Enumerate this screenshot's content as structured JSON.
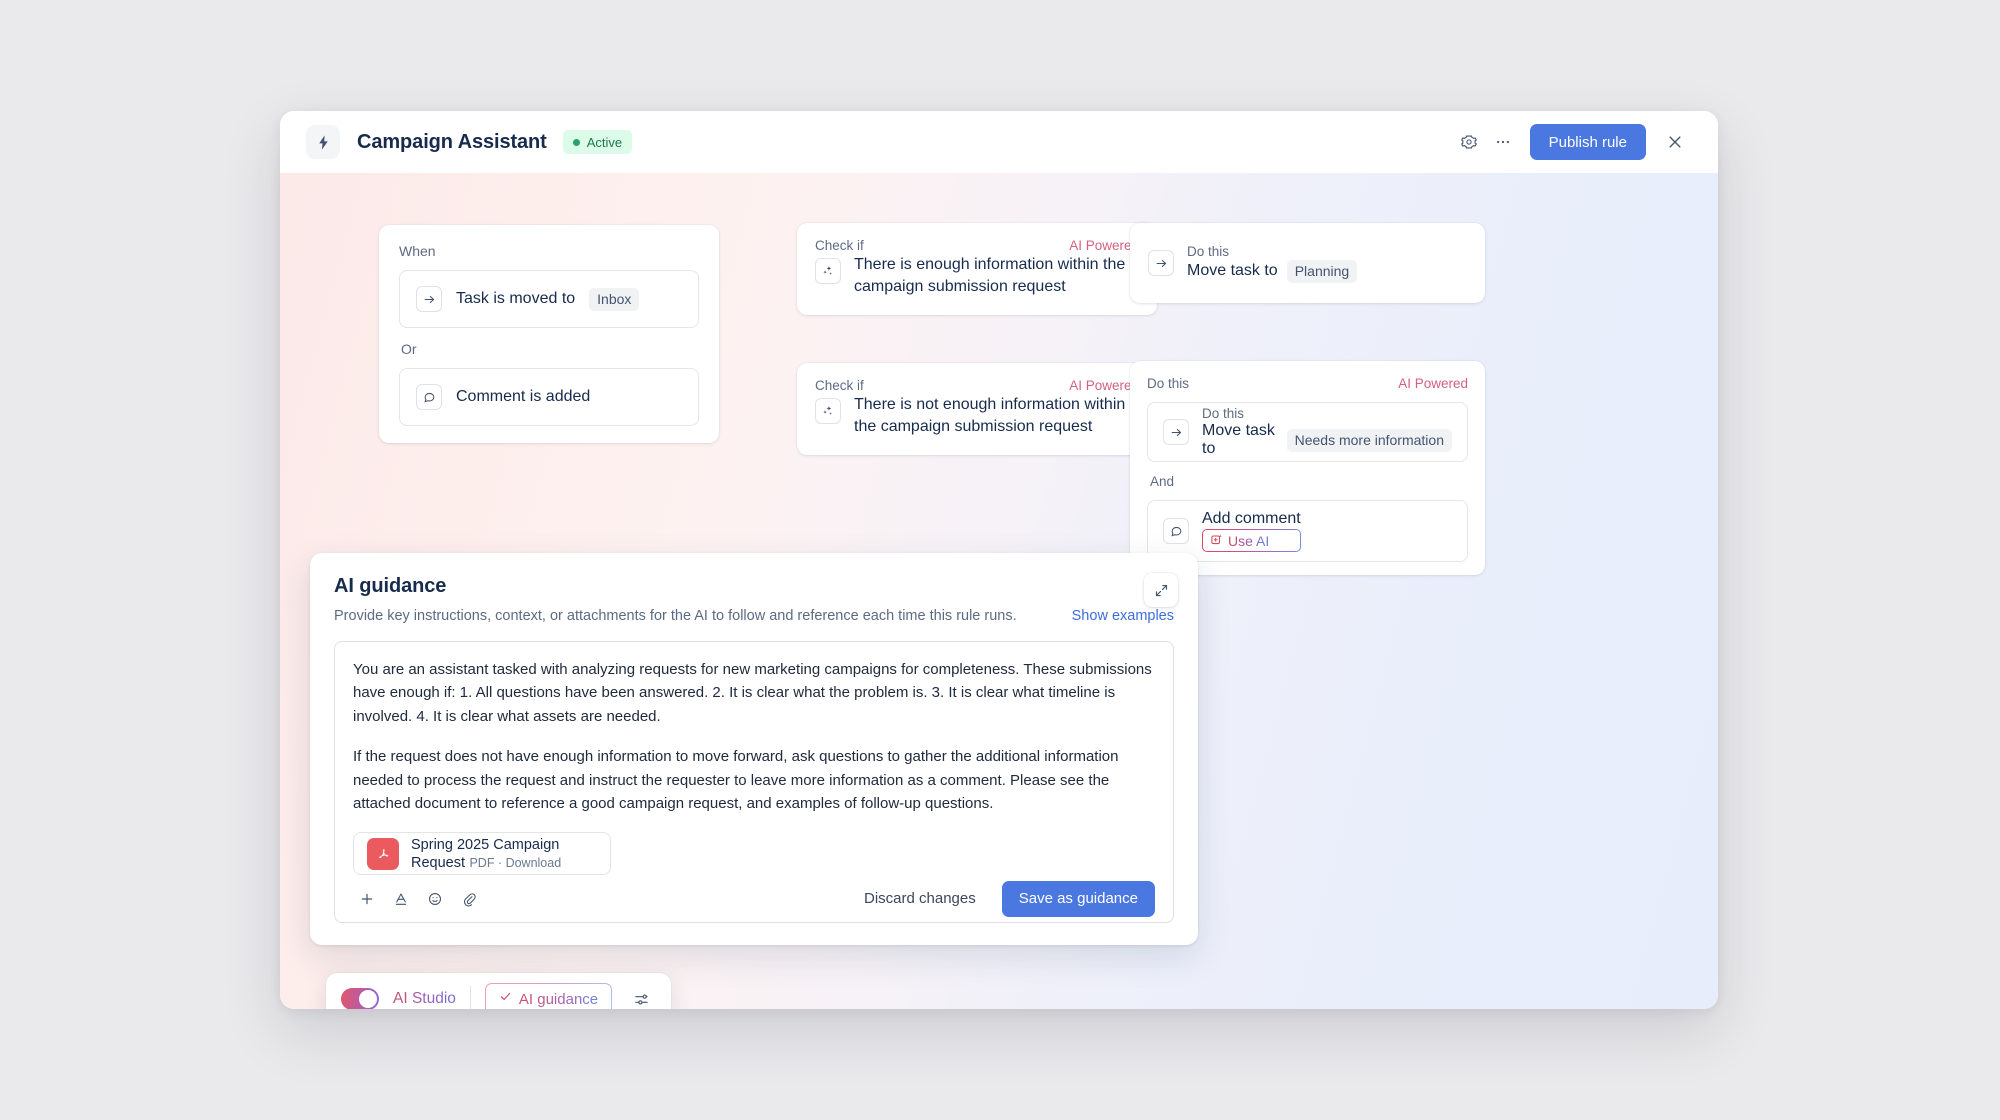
{
  "titlebar": {
    "rule_icon": "lightning-bolt-icon",
    "title": "Campaign Assistant",
    "status": "Active",
    "settings_icon": "gear-icon",
    "more_icon": "ellipsis-icon",
    "publish_label": "Publish rule",
    "close_icon": "close-icon"
  },
  "flow": {
    "when": {
      "when_label": "When",
      "or_label": "Or",
      "trigger_1": {
        "icon": "arrow-right-icon",
        "text": "Task is moved to",
        "value": "Inbox"
      },
      "trigger_2": {
        "icon": "comment-icon",
        "text": "Comment is added"
      }
    },
    "checks": [
      {
        "label": "Check if",
        "ai_badge": "AI Powered",
        "icon": "sparkle-icon",
        "text": "There is enough information within the campaign submission request"
      },
      {
        "label": "Check if",
        "ai_badge": "AI Powered",
        "icon": "sparkle-icon",
        "text": "There is not enough information within the campaign submission request"
      }
    ],
    "actions": {
      "simple": {
        "label": "Do this",
        "icon": "arrow-right-icon",
        "text": "Move task to",
        "value": "Planning"
      },
      "grouped": {
        "label": "Do this",
        "ai_badge": "AI Powered",
        "and_label": "And",
        "move": {
          "label": "Do this",
          "icon": "arrow-right-icon",
          "text": "Move task to",
          "value": "Needs more information"
        },
        "comment": {
          "icon": "comment-icon",
          "text": "Add comment",
          "use_ai_label": "Use AI",
          "use_ai_icon": "add-ai-icon"
        }
      }
    }
  },
  "ai_guidance": {
    "title": "AI guidance",
    "subtitle": "Provide key instructions, context, or attachments for the AI to follow and reference each time this rule runs.",
    "show_examples": "Show examples",
    "expand_icon": "expand-diagonal-icon",
    "paragraph_1": "You are an assistant tasked with analyzing requests for new marketing campaigns for completeness. These submissions have enough if:  1. All questions have been answered. 2. It is clear what the problem is. 3. It is clear what timeline is involved. 4. It is clear what assets are needed.",
    "paragraph_2": "If the request does not have enough information to move forward, ask questions to gather the additional information needed to process the request and instruct the requester to leave more information as a comment. Please see the attached document to reference a good campaign request, and examples of follow-up questions.",
    "attachment": {
      "icon": "pdf-file-icon",
      "name": "Spring 2025 Campaign Request",
      "meta": "PDF · Download"
    },
    "toolbar_icons": {
      "add": "plus-icon",
      "text_format": "text-format-icon",
      "emoji": "emoji-icon",
      "attach": "paperclip-icon"
    },
    "discard_label": "Discard changes",
    "save_label": "Save as guidance"
  },
  "studio_bar": {
    "toggle_icon": "toggle-on-icon",
    "label": "AI Studio",
    "chip_label": "AI guidance",
    "chip_icon": "check-icon",
    "settings_icon": "sliders-icon"
  },
  "colors": {
    "accent_blue": "#4a77e0",
    "ai_pink": "#d4607f",
    "status_green": "#1d7a4d",
    "pdf_red": "#ea5a5f"
  }
}
